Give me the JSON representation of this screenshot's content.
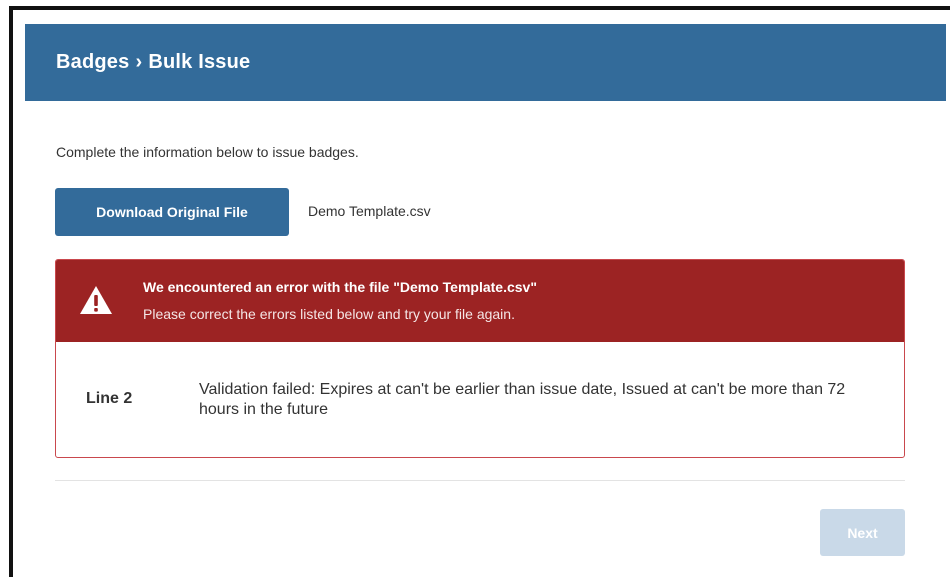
{
  "header": {
    "breadcrumb": {
      "parent": "Badges",
      "separator": "›",
      "current": "Bulk Issue"
    }
  },
  "intro_text": "Complete the information below to issue badges.",
  "download_button": {
    "label": "Download Original File"
  },
  "file_name": "Demo Template.csv",
  "error": {
    "icon": "warning-triangle-icon",
    "title": "We encountered an error with the file \"Demo Template.csv\"",
    "subtitle": "Please correct the errors listed below and try your file again.",
    "rows": [
      {
        "line": "Line 2",
        "message": "Validation failed: Expires at can't be earlier than issue date, Issued at can't be more than 72 hours in the future"
      }
    ]
  },
  "footer": {
    "next_label": "Next",
    "next_disabled": true
  },
  "colors": {
    "header": "#336b9a",
    "primary_button": "#336b9a",
    "error_header": "#9c2323",
    "error_border": "#c9484d",
    "disabled_button": "#c9d9e8"
  }
}
